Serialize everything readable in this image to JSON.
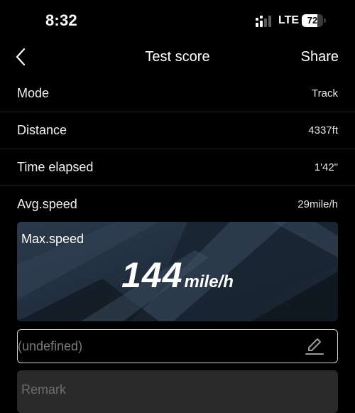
{
  "status_bar": {
    "time": "8:32",
    "carrier": "LTE",
    "battery_level": "72",
    "battery_fraction": 0.72,
    "icons": [
      "signal-icon",
      "battery-icon"
    ]
  },
  "nav": {
    "back_icon": "chevron-left-icon",
    "title": "Test score",
    "share_label": "Share"
  },
  "info_rows": [
    {
      "label": "Mode",
      "value": "Track"
    },
    {
      "label": "Distance",
      "value": "4337ft"
    },
    {
      "label": "Time elapsed",
      "value": "1'42\""
    },
    {
      "label": "Avg.speed",
      "value": "29mile/h"
    }
  ],
  "max_speed": {
    "label": "Max.speed",
    "value": "144",
    "unit": "mile/h"
  },
  "name_field": {
    "value": "(undefined)",
    "edit_icon": "pencil-icon"
  },
  "remark": {
    "placeholder": "Remark"
  },
  "colors": {
    "background": "#000000",
    "text": "#ffffff",
    "card": "#22303f",
    "divider": "#1e1e1e"
  }
}
